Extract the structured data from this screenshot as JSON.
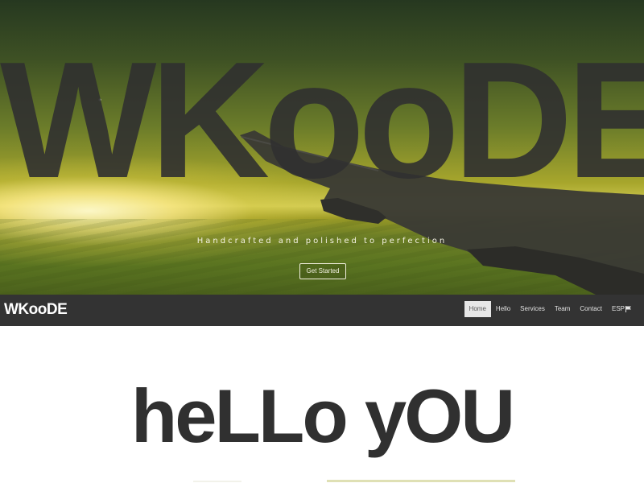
{
  "hero": {
    "title": "WKooDE",
    "tagline": "Handcrafted and polished to perfection",
    "cta_label": "Get Started"
  },
  "navbar": {
    "brand": "WKooDE",
    "items": [
      {
        "label": "Home",
        "active": true
      },
      {
        "label": "Hello",
        "active": false
      },
      {
        "label": "Services",
        "active": false
      },
      {
        "label": "Team",
        "active": false
      },
      {
        "label": "Contact",
        "active": false
      },
      {
        "label": "ESP",
        "active": false,
        "icon": "flag-icon"
      }
    ]
  },
  "section": {
    "heading": "heLLo yOU"
  },
  "colors": {
    "navbar_bg": "#333333",
    "active_nav_bg": "#e7e7e7",
    "title_text": "#303030",
    "accent_line": "#dfe0b4"
  }
}
